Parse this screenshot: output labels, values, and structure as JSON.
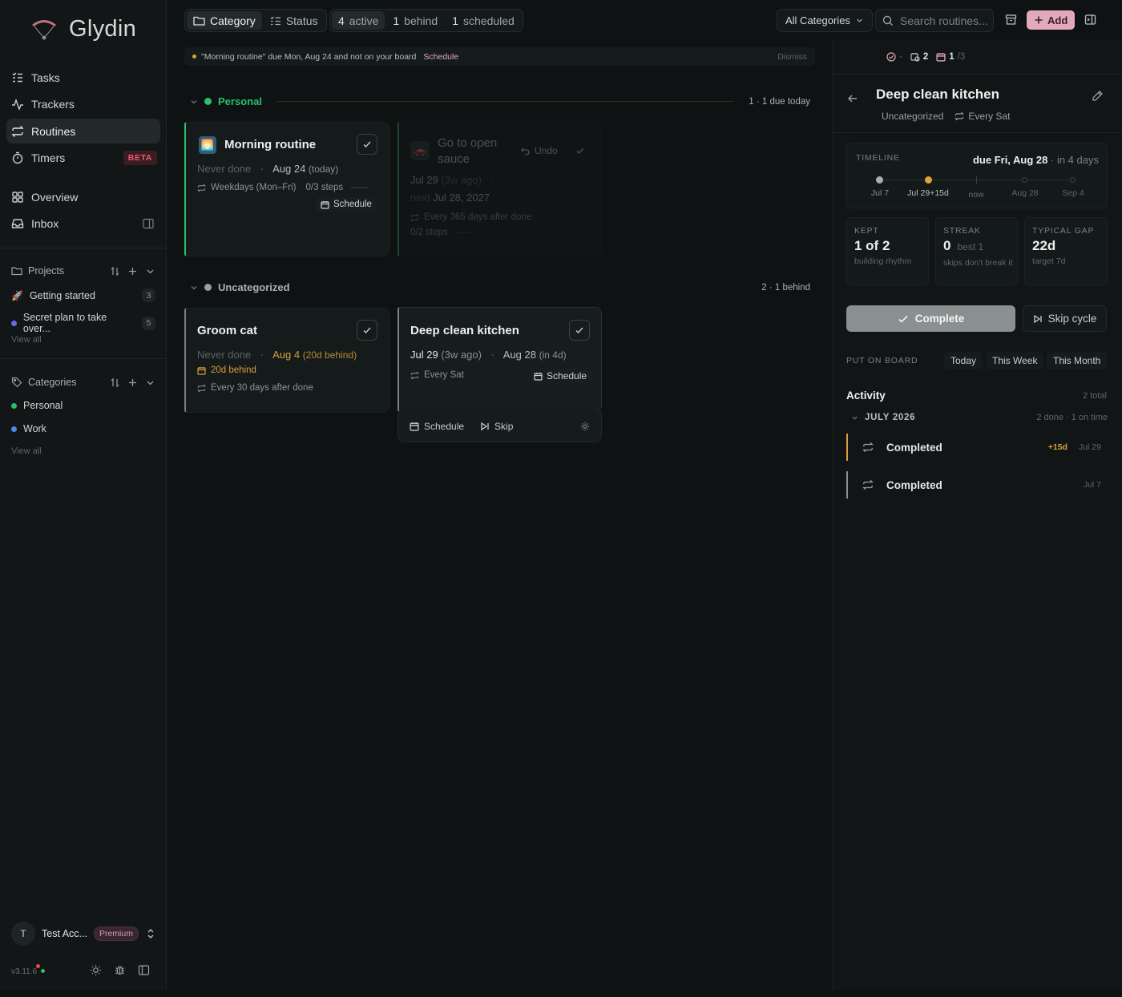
{
  "app": {
    "name": "Glydin",
    "version": "v3.11.6"
  },
  "sidebar": {
    "nav": [
      {
        "label": "Tasks",
        "icon": "tasks-icon"
      },
      {
        "label": "Trackers",
        "icon": "activity-icon"
      },
      {
        "label": "Routines",
        "icon": "repeat-icon",
        "active": true
      },
      {
        "label": "Timers",
        "icon": "timer-icon",
        "badge": "BETA"
      },
      {
        "label": "Overview",
        "icon": "grid-icon"
      },
      {
        "label": "Inbox",
        "icon": "inbox-icon"
      }
    ],
    "projects": {
      "title": "Projects",
      "items": [
        {
          "label": "Getting started",
          "count": "3",
          "icon": "rocket-icon"
        },
        {
          "label": "Secret plan to take over...",
          "count": "5",
          "color": "#6a6af0"
        }
      ],
      "view_all": "View all"
    },
    "categories": {
      "title": "Categories",
      "items": [
        {
          "label": "Personal",
          "color": "#2bbf6b"
        },
        {
          "label": "Work",
          "color": "#4a8cf0"
        }
      ],
      "view_all": "View all"
    },
    "account": {
      "initial": "T",
      "name": "Test Acc...",
      "plan": "Premium"
    }
  },
  "topbar": {
    "group_by": [
      {
        "label": "Category",
        "active": true
      },
      {
        "label": "Status"
      }
    ],
    "filters": [
      {
        "num": "4",
        "label": "active",
        "active": true
      },
      {
        "num": "1",
        "label": "behind"
      },
      {
        "num": "1",
        "label": "scheduled"
      }
    ],
    "category_select": "All Categories",
    "search_placeholder": "Search routines...",
    "add_label": "Add"
  },
  "banner": {
    "text": "\"Morning routine\" due Mon, Aug 24 and not on your board",
    "action": "Schedule",
    "dismiss": "Dismiss"
  },
  "groups": {
    "personal": {
      "name": "Personal",
      "meta": "1 · 1 due today",
      "color": "#2bbf6b"
    },
    "uncategorized": {
      "name": "Uncategorized",
      "meta": "2 · 1 behind",
      "color": "#9aa0a0"
    }
  },
  "cards": {
    "morning": {
      "title": "Morning routine",
      "last": "Never done",
      "due": "Aug 24",
      "due_note": "(today)",
      "repeat": "Weekdays (Mon–Fri)",
      "steps": "0/3 steps",
      "steps_progress": 0,
      "schedule": "Schedule"
    },
    "sauce": {
      "title_line1": "Go to open",
      "title_line2": "sauce",
      "undo": "Undo",
      "last": "Jul 29",
      "last_note": "(3w ago)",
      "next_label": "next",
      "next": "Jul 28, 2027",
      "repeat": "Every 365 days after done",
      "steps": "0/2 steps",
      "steps_progress": 0
    },
    "groom": {
      "title": "Groom cat",
      "last": "Never done",
      "due": "Aug 4",
      "due_note": "(20d behind)",
      "behind": "20d behind",
      "repeat": "Every 30 days after done"
    },
    "kitchen": {
      "title": "Deep clean kitchen",
      "last": "Jul 29",
      "last_note": "(3w ago)",
      "due": "Aug 28",
      "due_note": "(in 4d)",
      "repeat": "Every Sat",
      "schedule": "Schedule",
      "actions": {
        "schedule": "Schedule",
        "skip": "Skip"
      }
    }
  },
  "panel": {
    "stats": {
      "done_dash": "-",
      "scheduled": "2",
      "board": "1",
      "board_total": "/3"
    },
    "title": "Deep clean kitchen",
    "category": "Uncategorized",
    "repeat": "Every Sat",
    "timeline": {
      "label": "TIMELINE",
      "due": "due Fri, Aug 28",
      "due_rel": "· in 4 days",
      "points": [
        {
          "label": "Jul 7",
          "kind": "done"
        },
        {
          "label": "Jul 29+15d",
          "kind": "late"
        },
        {
          "label": "now",
          "kind": "now"
        },
        {
          "label": "Aug 28",
          "kind": "future"
        },
        {
          "label": "Sep 4",
          "kind": "future"
        }
      ]
    },
    "kept": {
      "label": "KEPT",
      "value": "1 of 2",
      "sub": "building rhythm"
    },
    "streak": {
      "label": "STREAK",
      "value": "0",
      "best": "best 1",
      "sub": "skips don't break it"
    },
    "gap": {
      "label": "TYPICAL GAP",
      "value": "22d",
      "sub": "target 7d"
    },
    "complete": "Complete",
    "skip": "Skip cycle",
    "board_label": "PUT ON BOARD",
    "board_options": [
      "Today",
      "This Week",
      "This Month"
    ],
    "activity": {
      "title": "Activity",
      "total": "2 total",
      "month": "JULY 2026",
      "month_meta": "2 done · 1 on time",
      "rows": [
        {
          "label": "Completed",
          "delta": "+15d",
          "date": "Jul 29",
          "color": "#d6a13a"
        },
        {
          "label": "Completed",
          "delta": "",
          "date": "Jul 7",
          "color": "#8a9090"
        }
      ]
    }
  },
  "colors": {
    "accent": "#e2a9bd",
    "green": "#2bbf6b",
    "amber": "#d6a13a",
    "beta": "#e85c73"
  }
}
